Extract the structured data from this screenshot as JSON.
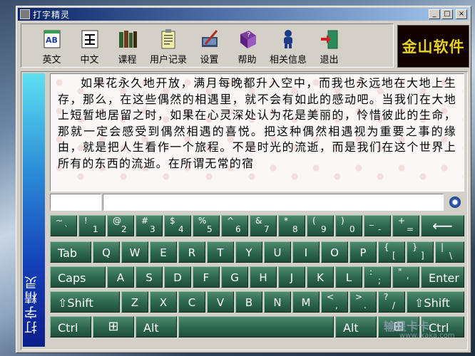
{
  "window": {
    "title": "打字精灵",
    "buttons": {
      "minimize": "_",
      "maximize": "□",
      "close": "×"
    }
  },
  "toolbar": [
    {
      "label": "英文",
      "icon": "english-book-icon"
    },
    {
      "label": "中文",
      "icon": "chinese-book-icon"
    },
    {
      "label": "课程",
      "icon": "books-icon"
    },
    {
      "label": "用户记录",
      "icon": "notepad-icon"
    },
    {
      "label": "设置",
      "icon": "settings-pen-icon"
    },
    {
      "label": "帮助",
      "icon": "help-book-icon"
    },
    {
      "label": "相关信息",
      "icon": "person-info-icon"
    },
    {
      "label": "退出",
      "icon": "exit-door-icon"
    }
  ],
  "logo": "金山软件",
  "sidebar_text": "打字精灵",
  "passage": "如果花永久地开放，满月每晚都升入空中，而我也永远地在大地上生存，那么，在这些偶然的相遇里，就不会有如此的感动吧。当我们在大地上短暂地居留之时，如果在心灵深处认为花是美丽的，怜惜彼此的生命，那就一定会感受到偶然相遇的喜悦。把这种偶然相遇视为重要之事的缘由，就是把人生看作一个旅程。不是时光的流逝，而是我们在这个世界上所有的东西的流逝。在所谓无常的宿",
  "keyboard": {
    "row1": [
      {
        "top": "~",
        "bot": "`"
      },
      {
        "top": "!",
        "bot": "1"
      },
      {
        "top": "@",
        "bot": "2"
      },
      {
        "top": "#",
        "bot": "3"
      },
      {
        "top": "$",
        "bot": "4"
      },
      {
        "top": "%",
        "bot": "5"
      },
      {
        "top": "^",
        "bot": "6"
      },
      {
        "top": "&",
        "bot": "7"
      },
      {
        "top": "*",
        "bot": "8"
      },
      {
        "top": "(",
        "bot": "9"
      },
      {
        "top": ")",
        "bot": "0"
      },
      {
        "top": "_",
        "bot": "-"
      },
      {
        "top": "+",
        "bot": "="
      }
    ],
    "backspace": "⟵",
    "tab": "Tab",
    "row2": [
      "Q",
      "W",
      "E",
      "R",
      "T",
      "Y",
      "U",
      "I",
      "O",
      "P"
    ],
    "row2_sym": [
      {
        "top": "{",
        "bot": "["
      },
      {
        "top": "}",
        "bot": "]"
      },
      {
        "top": "|",
        "bot": "\\"
      }
    ],
    "caps": "Caps",
    "row3": [
      "A",
      "S",
      "D",
      "F",
      "G",
      "H",
      "J",
      "K",
      "L"
    ],
    "row3_sym": [
      {
        "top": ":",
        "bot": ";"
      },
      {
        "top": "\"",
        "bot": "'"
      }
    ],
    "enter": "Enter",
    "shift_left": "⇧Shift",
    "row4": [
      "Z",
      "X",
      "C",
      "V",
      "B",
      "N",
      "M"
    ],
    "row4_sym": [
      {
        "top": "<",
        "bot": ","
      },
      {
        "top": ">",
        "bot": "."
      },
      {
        "top": "?",
        "bot": "/"
      }
    ],
    "shift_right": "⇧Shift",
    "ctrl_left": "Ctrl",
    "win_left": "⊞",
    "alt_left": "Alt",
    "alt_right": "Alt",
    "win_right": "⊞",
    "ctrl_right": "Ctrl"
  },
  "watermark": "输星卡卡",
  "watermark_url": "www.ikaka.com"
}
